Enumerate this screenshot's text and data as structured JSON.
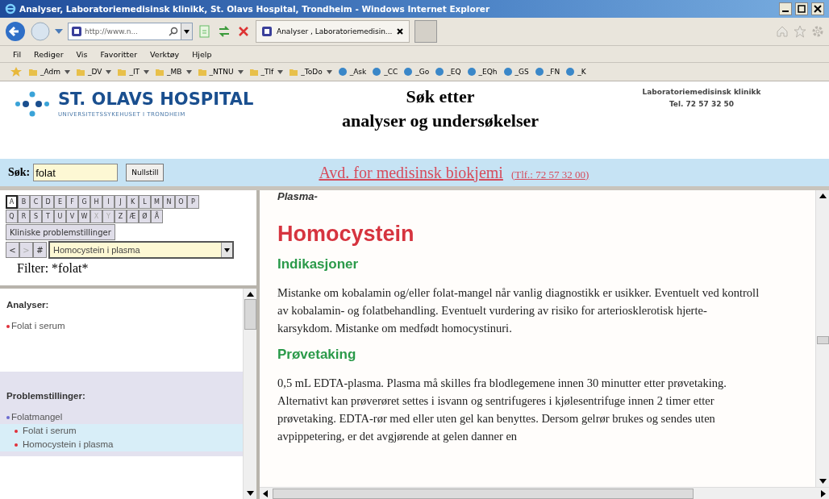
{
  "window": {
    "title": "Analyser, Laboratoriemedisinsk klinikk, St. Olavs Hospital, Trondheim - Windows Internet Explorer"
  },
  "address_bar": {
    "value": "http://www.n..."
  },
  "tabs": [
    {
      "label": "Analyser , Laboratoriemedisin...",
      "selected": true
    }
  ],
  "menu": [
    "Fil",
    "Rediger",
    "Vis",
    "Favoritter",
    "Verktøy",
    "Hjelp"
  ],
  "favorites": [
    {
      "label": "_Adm",
      "kind": "folder"
    },
    {
      "label": "_DV",
      "kind": "folder"
    },
    {
      "label": "_IT",
      "kind": "folder"
    },
    {
      "label": "_MB",
      "kind": "folder"
    },
    {
      "label": "_NTNU",
      "kind": "folder"
    },
    {
      "label": "_Tlf",
      "kind": "folder"
    },
    {
      "label": "_ToDo",
      "kind": "folder"
    },
    {
      "label": "_Ask",
      "kind": "link"
    },
    {
      "label": "_CC",
      "kind": "link"
    },
    {
      "label": "_Go",
      "kind": "link"
    },
    {
      "label": "_EQ",
      "kind": "link"
    },
    {
      "label": "_EQh",
      "kind": "link"
    },
    {
      "label": "_GS",
      "kind": "link"
    },
    {
      "label": "_FN",
      "kind": "link"
    },
    {
      "label": "_K",
      "kind": "link"
    }
  ],
  "header": {
    "logo_name": "ST. OLAVS HOSPITAL",
    "logo_subtitle": "UNIVERSITETSSYKEHUSET I TRONDHEIM",
    "title_line_1": "Søk etter",
    "title_line_2": "analyser og undersøkelser",
    "clinic": "Laboratoriemedisinsk klinikk",
    "phone": "Tel. 72 57 32 50"
  },
  "search": {
    "label": "Søk:",
    "value": "folat",
    "reset_button": "Nullstill",
    "department_link": "Avd. for medisinsk biokjemi",
    "department_phone": "(Tlf.: 72 57 32 00)"
  },
  "letters": [
    {
      "label": "A",
      "selected": true,
      "disabled": false
    },
    {
      "label": "B",
      "selected": false,
      "disabled": false
    },
    {
      "label": "C",
      "selected": false,
      "disabled": false
    },
    {
      "label": "D",
      "selected": false,
      "disabled": false
    },
    {
      "label": "E",
      "selected": false,
      "disabled": false
    },
    {
      "label": "F",
      "selected": false,
      "disabled": false
    },
    {
      "label": "G",
      "selected": false,
      "disabled": false
    },
    {
      "label": "H",
      "selected": false,
      "disabled": false
    },
    {
      "label": "I",
      "selected": false,
      "disabled": false
    },
    {
      "label": "J",
      "selected": false,
      "disabled": false
    },
    {
      "label": "K",
      "selected": false,
      "disabled": false
    },
    {
      "label": "L",
      "selected": false,
      "disabled": false
    },
    {
      "label": "M",
      "selected": false,
      "disabled": false
    },
    {
      "label": "N",
      "selected": false,
      "disabled": false
    },
    {
      "label": "O",
      "selected": false,
      "disabled": false
    },
    {
      "label": "P",
      "selected": false,
      "disabled": false
    },
    {
      "label": "Q",
      "selected": false,
      "disabled": false
    },
    {
      "label": "R",
      "selected": false,
      "disabled": false
    },
    {
      "label": "S",
      "selected": false,
      "disabled": false
    },
    {
      "label": "T",
      "selected": false,
      "disabled": false
    },
    {
      "label": "U",
      "selected": false,
      "disabled": false
    },
    {
      "label": "V",
      "selected": false,
      "disabled": false
    },
    {
      "label": "W",
      "selected": false,
      "disabled": false
    },
    {
      "label": "X",
      "selected": false,
      "disabled": true
    },
    {
      "label": "Y",
      "selected": false,
      "disabled": true
    },
    {
      "label": "Z",
      "selected": false,
      "disabled": false
    },
    {
      "label": "Æ",
      "selected": false,
      "disabled": false
    },
    {
      "label": "Ø",
      "selected": false,
      "disabled": false
    },
    {
      "label": "Å",
      "selected": false,
      "disabled": false
    }
  ],
  "problems_button": "Kliniske problemstillinger",
  "nav_buttons": [
    {
      "label": "<",
      "disabled": false
    },
    {
      "label": ">",
      "disabled": true
    },
    {
      "label": "#",
      "disabled": false
    }
  ],
  "analysis_select": {
    "value": "Homocystein i plasma"
  },
  "filter": "Filter: *folat*",
  "analyses": {
    "heading": "Analyser:",
    "items": [
      "Folat i serum"
    ]
  },
  "problems": {
    "heading": "Problemstillinger:",
    "items": [
      {
        "label": "Folatmangel",
        "children": [
          {
            "label": "Folat i serum"
          },
          {
            "label": "Homocystein i plasma"
          }
        ]
      }
    ]
  },
  "article": {
    "material": "Plasma-",
    "title": "Homocystein",
    "sections": [
      {
        "heading": "Indikasjoner",
        "text": "Mistanke om kobalamin og/eller folat-mangel når vanlig diagnostikk er usikker. Eventuelt ved kontroll av kobalamin- og folatbehandling. Eventuelt vurdering av risiko for arteriosklerotisk hjerte-karsykdom. Mistanke om medfødt homocystinuri."
      },
      {
        "heading": "Prøvetaking",
        "text": "0,5 mL EDTA-plasma. Plasma må skilles fra blodlegemene innen 30 minutter etter prøvetaking. Alternativt kan prøverøret settes i isvann og sentrifugeres i kjølesentrifuge innen 2 timer etter prøvetaking. EDTA-rør med eller uten gel kan benyttes. Dersom gelrør brukes og sendes uten avpippetering, er det avgjørende at gelen danner en"
      }
    ]
  }
}
